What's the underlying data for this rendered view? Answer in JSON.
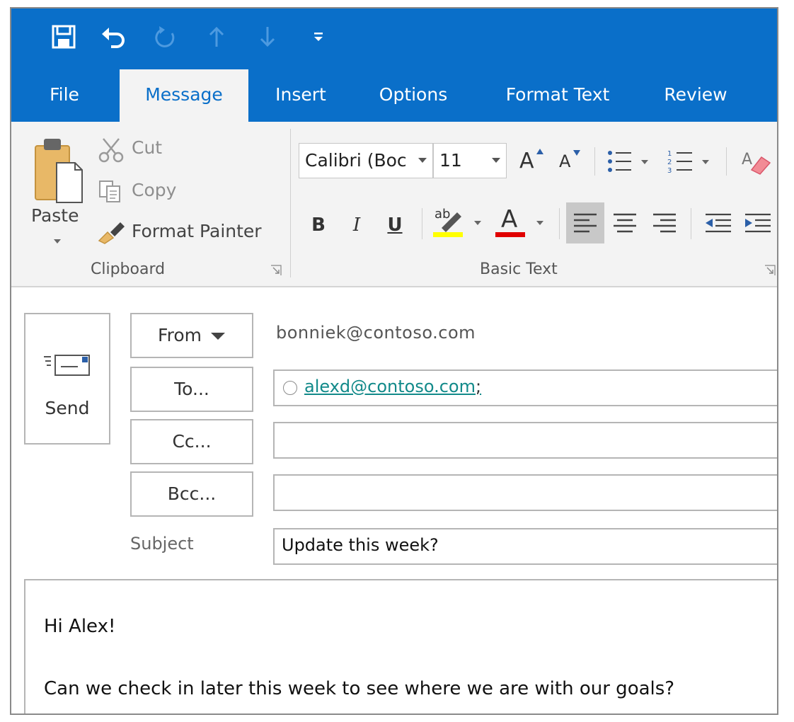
{
  "quick_access": {
    "icons": [
      "save-icon",
      "undo-icon",
      "redo-icon",
      "previous-item-icon",
      "next-item-icon",
      "customize-toolbar-icon"
    ]
  },
  "tabs": [
    {
      "label": "File"
    },
    {
      "label": "Message",
      "active": true
    },
    {
      "label": "Insert"
    },
    {
      "label": "Options"
    },
    {
      "label": "Format Text"
    },
    {
      "label": "Review"
    }
  ],
  "ribbon": {
    "clipboard": {
      "paste_label": "Paste",
      "cut_label": "Cut",
      "copy_label": "Copy",
      "format_painter_label": "Format Painter",
      "group_label": "Clipboard"
    },
    "basic_text": {
      "font_name": "Calibri (Boc",
      "font_size": "11",
      "bold": "B",
      "italic": "I",
      "underline": "U",
      "font_color_glyph": "A",
      "grow_glyph": "A",
      "shrink_glyph": "A",
      "group_label": "Basic Text",
      "highlight_color": "#ffff00",
      "font_color": "#e00000"
    }
  },
  "compose": {
    "send_label": "Send",
    "from_button": "From",
    "from_value": "bonniek@contoso.com",
    "to_button": "To...",
    "to_recipient": "alexd@contoso.com",
    "to_separator": ";",
    "cc_button": "Cc...",
    "bcc_button": "Bcc...",
    "subject_label": "Subject",
    "subject_value": "Update this week?",
    "body_lines": [
      "Hi Alex!",
      "Can we check in later this week to see where we are with our goals?"
    ]
  },
  "colors": {
    "accent": "#0a6fc9",
    "ribbon_bg": "#f3f3f3",
    "link": "#128a8a"
  }
}
